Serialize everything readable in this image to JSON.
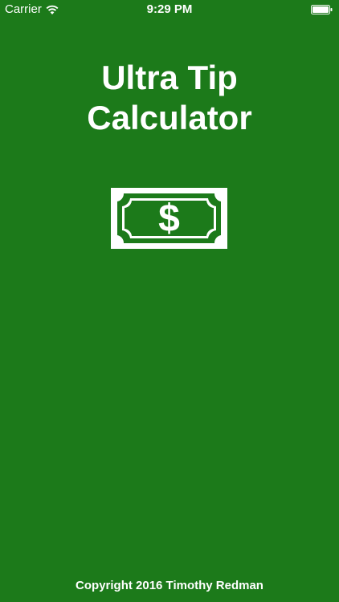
{
  "status_bar": {
    "carrier": "Carrier",
    "time": "9:29 PM",
    "wifi_icon": "wifi-icon",
    "battery_icon": "battery-icon"
  },
  "app": {
    "title_line1": "Ultra Tip",
    "title_line2": "Calculator",
    "logo_icon": "dollar-bill-icon",
    "logo_symbol": "$",
    "copyright": "Copyright 2016 Timothy Redman"
  },
  "colors": {
    "background": "#1c7a1a",
    "foreground": "#ffffff"
  }
}
